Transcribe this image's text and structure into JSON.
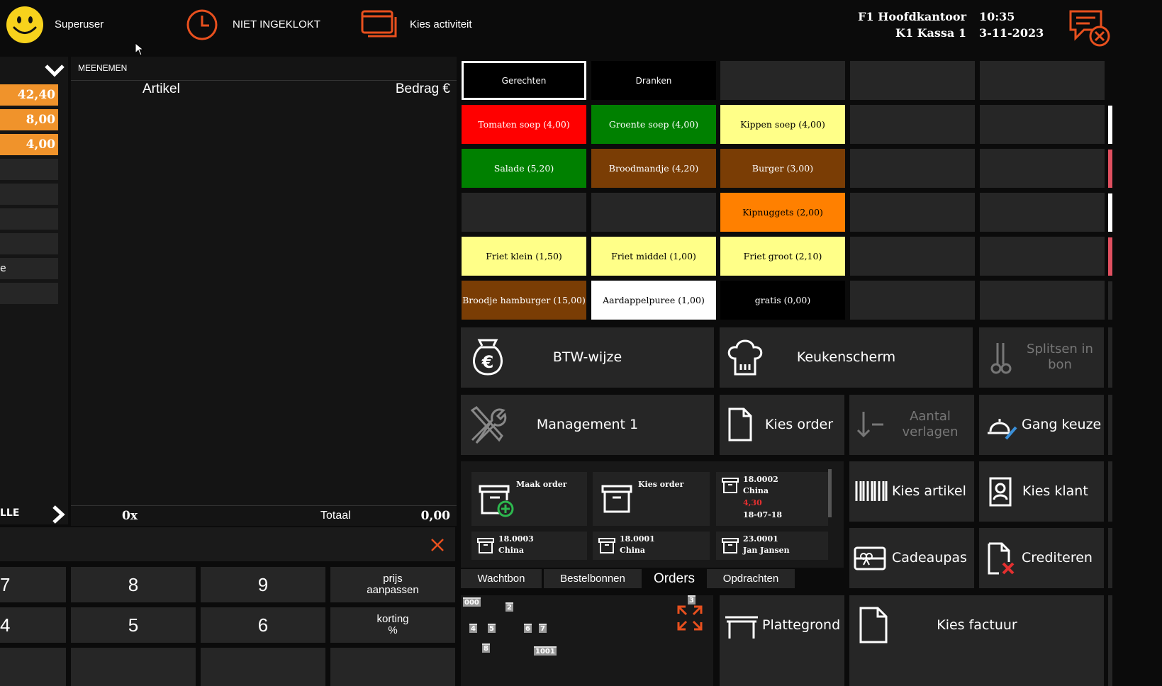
{
  "header": {
    "user": "Superuser",
    "clock_status": "NIET INGEKLOKT",
    "activity": "Kies activiteit",
    "location": "F1 Hoofdkantoor",
    "register": "K1 Kassa 1",
    "time": "10:35",
    "date": "3-11-2023"
  },
  "left_panel": {
    "amounts": [
      "42,40",
      "8,00",
      "4,00"
    ],
    "partial_label": "e",
    "bottom_label": "LLE"
  },
  "order": {
    "mode": "MEENEMEN",
    "col_article": "Artikel",
    "col_amount": "Bedrag €",
    "count": "0x",
    "total_label": "Totaal",
    "total_value": "0,00"
  },
  "categories": [
    "Gerechten",
    "Dranken"
  ],
  "products": [
    {
      "label": "Tomaten soep (4,00)",
      "bg": "#ff0000",
      "fg": "#ffffff"
    },
    {
      "label": "Groente soep (4,00)",
      "bg": "#008000",
      "fg": "#ffffff"
    },
    {
      "label": "Kippen soep (4,00)",
      "bg": "#ffff88",
      "fg": "#000000"
    },
    {
      "label": "Salade (5,20)",
      "bg": "#008000",
      "fg": "#ffffff"
    },
    {
      "label": "Broodmandje (4,20)",
      "bg": "#7a3d05",
      "fg": "#ffffff"
    },
    {
      "label": "Burger (3,00)",
      "bg": "#7a3d05",
      "fg": "#ffffff"
    },
    {
      "label": "Kipnuggets (2,00)",
      "bg": "#ff8000",
      "fg": "#000000"
    },
    {
      "label": "Friet klein (1,50)",
      "bg": "#ffff88",
      "fg": "#000000"
    },
    {
      "label": "Friet middel (1,00)",
      "bg": "#ffff88",
      "fg": "#000000"
    },
    {
      "label": "Friet groot (2,10)",
      "bg": "#ffff88",
      "fg": "#000000"
    },
    {
      "label": "Broodje hamburger (15,00)",
      "bg": "#7a3d05",
      "fg": "#ffffff"
    },
    {
      "label": "Aardappelpuree (1,00)",
      "bg": "#ffffff",
      "fg": "#000000"
    },
    {
      "label": "gratis (0,00)",
      "bg": "#000000",
      "fg": "#ffffff"
    }
  ],
  "actions": {
    "btw": "BTW-wijze",
    "kitchen": "Keukenscherm",
    "split": "Splitsen in bon",
    "management": "Management 1",
    "choose_order": "Kies order",
    "decrease": "Aantal verlagen",
    "course": "Gang keuze",
    "choose_article": "Kies artikel",
    "choose_customer": "Kies klant",
    "giftcard": "Cadeaupas",
    "credit": "Crediteren",
    "floorplan": "Plattegrond",
    "choose_invoice": "Kies factuur"
  },
  "orders_panel": {
    "make_order": "Maak order",
    "choose_order": "Kies order",
    "cards": [
      {
        "number": "18.0002",
        "name": "China",
        "amount": "4,30",
        "date": "18-07-18"
      },
      {
        "number": "18.0003",
        "name": "China"
      },
      {
        "number": "18.0001",
        "name": "China"
      },
      {
        "number": "23.0001",
        "name": "Jan Jansen"
      }
    ],
    "tabs": [
      "Wachtbon",
      "Bestelbonnen",
      "Orders",
      "Opdrachten"
    ],
    "active_tab": "Orders"
  },
  "keypad": {
    "keys": [
      "7",
      "8",
      "9",
      "4",
      "5",
      "6"
    ],
    "price_adjust": "prijs\naanpassen",
    "discount": "korting\n%"
  },
  "floor_tables": [
    "000",
    "2",
    "3",
    "4",
    "5",
    "6",
    "7",
    "8",
    "1001"
  ],
  "colors": {
    "accent": "#e8501e",
    "tile": "#262626",
    "amount_orange": "#f0932b",
    "negative_red": "#e53030"
  }
}
